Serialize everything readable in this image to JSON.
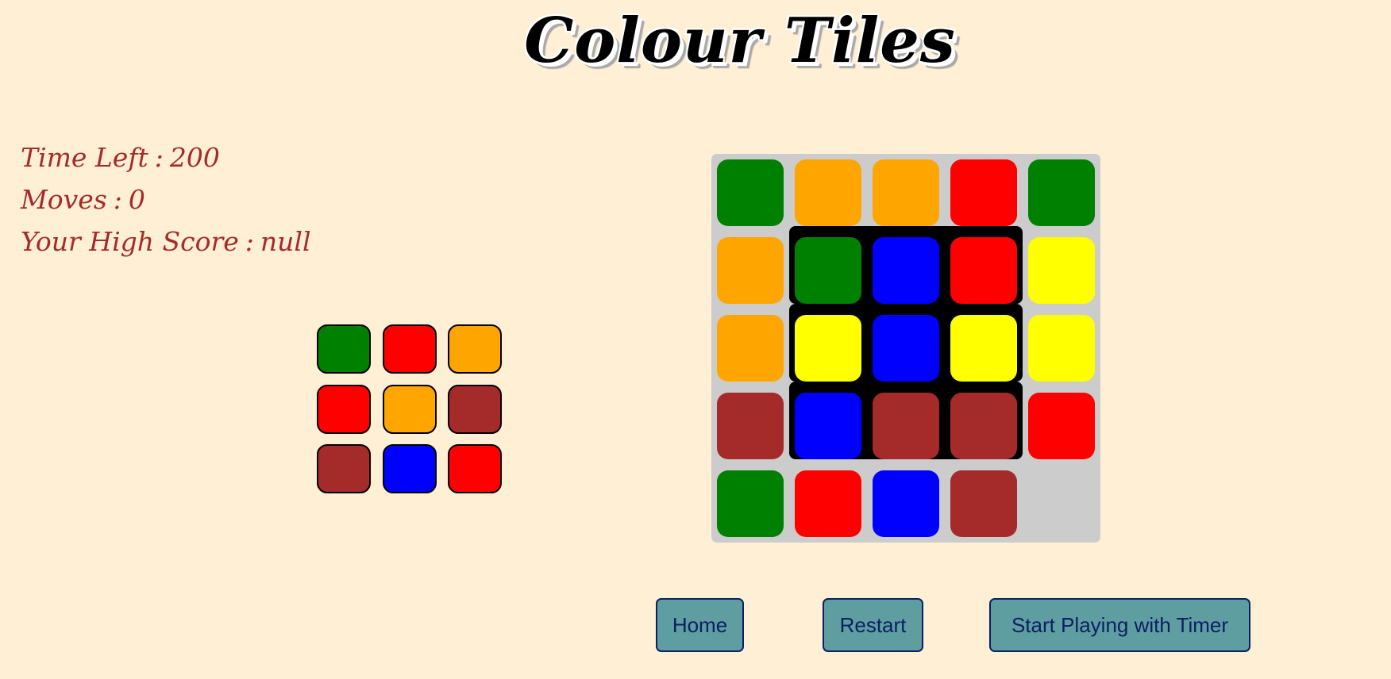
{
  "title": "Colour Tiles",
  "stats": {
    "time_left_label": "Time Left",
    "time_left_value": "200",
    "moves_label": "Moves",
    "moves_value": "0",
    "high_score_label": "Your High Score",
    "high_score_value": "null",
    "separator": ":"
  },
  "colors": {
    "green": "#008000",
    "orange": "#ffa500",
    "red": "#ff0000",
    "yellow": "#ffff00",
    "blue": "#0000ff",
    "brown": "#a52a2a",
    "empty": "#cccccc",
    "background": "#ffefd5",
    "text_brown": "#a52a2a",
    "button_bg": "#5f9ea0",
    "button_text": "#0b1f63"
  },
  "target_pattern": [
    [
      "green",
      "red",
      "orange"
    ],
    [
      "red",
      "orange",
      "brown"
    ],
    [
      "brown",
      "blue",
      "red"
    ]
  ],
  "board": [
    [
      "green",
      "orange",
      "orange",
      "red",
      "green"
    ],
    [
      "orange",
      "green",
      "blue",
      "red",
      "yellow"
    ],
    [
      "orange",
      "yellow",
      "blue",
      "yellow",
      "yellow"
    ],
    [
      "brown",
      "blue",
      "brown",
      "brown",
      "red"
    ],
    [
      "green",
      "red",
      "blue",
      "brown",
      "empty"
    ]
  ],
  "empty_cell": {
    "row": 4,
    "col": 4
  },
  "buttons": {
    "home": "Home",
    "restart": "Restart",
    "timer": "Start Playing with Timer"
  }
}
